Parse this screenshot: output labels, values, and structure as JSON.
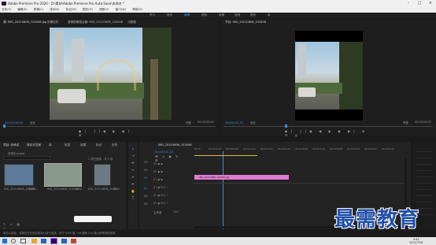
{
  "window": {
    "title": "Adobe Premiere Pro 2020 - D:\\素材\\Adobe Premiere Pro Auto-Save\\未命名 *"
  },
  "menu": [
    "文件(F)",
    "编辑(E)",
    "剪辑(C)",
    "序列(S)",
    "标记(M)",
    "图形(G)",
    "视图(V)",
    "窗口(W)",
    "帮助(H)"
  ],
  "workspaces": [
    "学习",
    "组件",
    "编辑",
    "颜色",
    "效果",
    "音频",
    "图形",
    "库"
  ],
  "source": {
    "tabs": [
      "源: IMG_20210806_103458.jpg",
      "效果控件",
      "音频剪辑混合器: IMG_20210806_103458",
      "元数据"
    ],
    "timecode_left": "00;00;00;00",
    "fit": "适合",
    "ratio": "完整",
    "timecode_right": "00;00;05;00"
  },
  "program": {
    "tab": "节目: IMG_20210806_103458",
    "timecode_left": "00;00;01;13",
    "fit": "适合",
    "ratio": "完整",
    "timecode_right": "00;00;05;00"
  },
  "project": {
    "tabs": [
      "项目: 未命名",
      "媒体浏览器",
      "库",
      "信息",
      "效果",
      "标记",
      "历史"
    ],
    "name": "未命名.prproj",
    "count": "1 项已选择，共 3 项",
    "items": [
      {
        "name": "IMG_20210806_103458...",
        "dur": "5;00"
      },
      {
        "name": "IMG_20210806_103458...",
        "dur": "5;00"
      },
      {
        "name": "IMG_20210806_1043...",
        "dur": "5;00"
      }
    ]
  },
  "timeline": {
    "tab": "IMG_20210806_103458",
    "timecode": "00;00;01;13",
    "ruler": [
      "00;00",
      "00;00;04;29",
      "00;00;09;29",
      "00;00;14;29",
      "00;00;19;29",
      "00;00;24;29",
      "00;00;29;29",
      "00;00;34;28",
      "00;00;39;28",
      "00;00;44;28",
      "00;00;49;28",
      "00;00;54;28",
      "00;01;04;02"
    ],
    "tracks_video": [
      "V3",
      "V2",
      "V1"
    ],
    "tracks_audio": [
      "A1",
      "A2",
      "A3"
    ],
    "master": "主声道",
    "master_val": "0.0",
    "clip": "IMG_20210806_103458.jpg"
  },
  "status_text": "单击以选择，或单击空白处并拖动以进行选择。按下 Shift 键、Alt 键和 Ctrl 键以获得其他选项。",
  "taskbar": {
    "time": "9:42",
    "date": "2021/7/28"
  },
  "watermark": "最需教育",
  "colors": {
    "accent": "#3a8ee6",
    "clip": "#e07ad2"
  }
}
